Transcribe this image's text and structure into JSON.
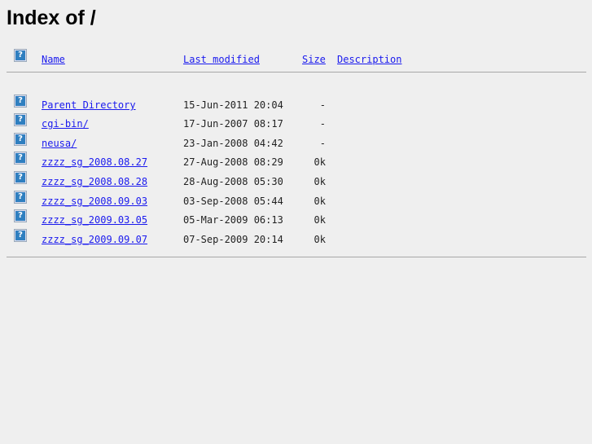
{
  "title": "Index of /",
  "columns": {
    "name": "Name",
    "last_modified": "Last modified",
    "size": "Size",
    "description": "Description"
  },
  "icon": "unknown-file-icon",
  "icon_glyph": "?",
  "rows": [
    {
      "name": "Parent Directory",
      "date": "15-Jun-2011 20:04",
      "size": "-"
    },
    {
      "name": "cgi-bin/",
      "date": "17-Jun-2007 08:17",
      "size": "-"
    },
    {
      "name": "neusa/",
      "date": "23-Jan-2008 04:42",
      "size": "-"
    },
    {
      "name": "zzzz_sg_2008.08.27",
      "date": "27-Aug-2008 08:29",
      "size": "0k"
    },
    {
      "name": "zzzz_sg_2008.08.28",
      "date": "28-Aug-2008 05:30",
      "size": "0k"
    },
    {
      "name": "zzzz_sg_2008.09.03",
      "date": "03-Sep-2008 05:44",
      "size": "0k"
    },
    {
      "name": "zzzz_sg_2009.03.05",
      "date": "05-Mar-2009 06:13",
      "size": "0k"
    },
    {
      "name": "zzzz_sg_2009.09.07",
      "date": "07-Sep-2009 20:14",
      "size": "0k"
    }
  ]
}
